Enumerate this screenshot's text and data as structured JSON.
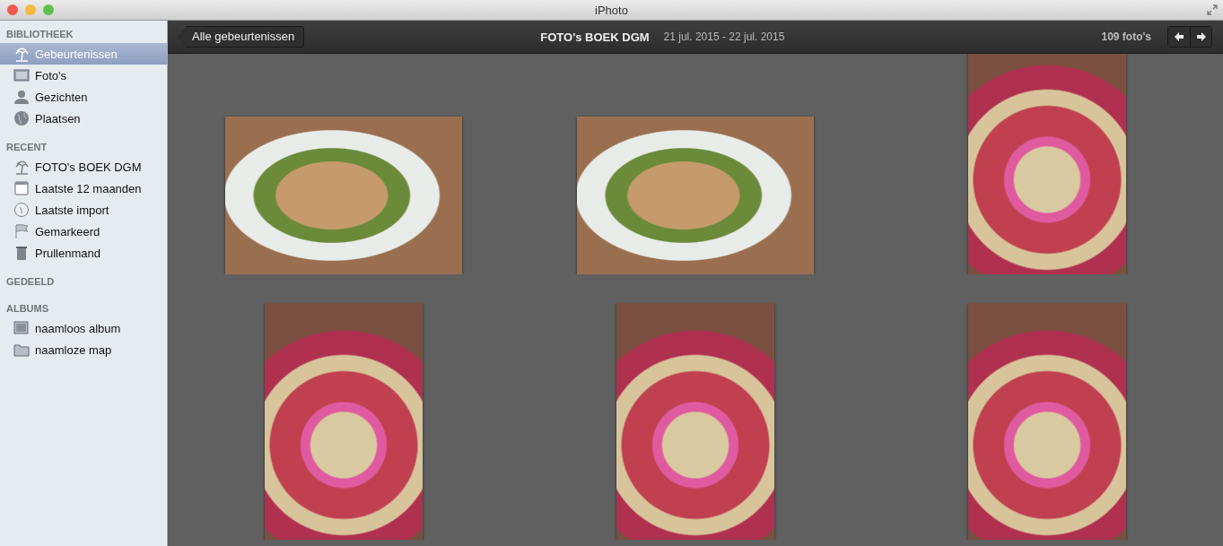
{
  "window": {
    "title": "iPhoto"
  },
  "sidebar": {
    "sections": [
      {
        "heading": "BIBLIOTHEEK",
        "items": [
          {
            "label": "Gebeurtenissen",
            "kind": "palm",
            "selected": true
          },
          {
            "label": "Foto's",
            "kind": "photo",
            "selected": false
          },
          {
            "label": "Gezichten",
            "kind": "person",
            "selected": false
          },
          {
            "label": "Plaatsen",
            "kind": "globe",
            "selected": false
          }
        ]
      },
      {
        "heading": "RECENT",
        "items": [
          {
            "label": "FOTO's BOEK DGM",
            "kind": "palm",
            "selected": false
          },
          {
            "label": "Laatste 12 maanden",
            "kind": "calendar",
            "selected": false
          },
          {
            "label": "Laatste import",
            "kind": "clock",
            "selected": false
          },
          {
            "label": "Gemarkeerd",
            "kind": "flag",
            "selected": false
          },
          {
            "label": "Prullenmand",
            "kind": "trash",
            "selected": false
          }
        ]
      },
      {
        "heading": "GEDEELD"
      },
      {
        "heading": "ALBUMS",
        "items": [
          {
            "label": "naamloos album",
            "kind": "album",
            "selected": false
          },
          {
            "label": "naamloze map",
            "kind": "folder",
            "selected": false
          }
        ]
      }
    ]
  },
  "toolbar": {
    "back_button": "Alle gebeurtenissen",
    "event_title": "FOTO's BOEK DGM",
    "date_range": "21 jul. 2015 - 22 jul. 2015",
    "photo_count": "109 foto's"
  },
  "photos": [
    {
      "kind": "landscape"
    },
    {
      "kind": "landscape"
    },
    {
      "kind": "portrait"
    },
    {
      "kind": "portrait"
    },
    {
      "kind": "portrait"
    },
    {
      "kind": "portrait"
    }
  ]
}
